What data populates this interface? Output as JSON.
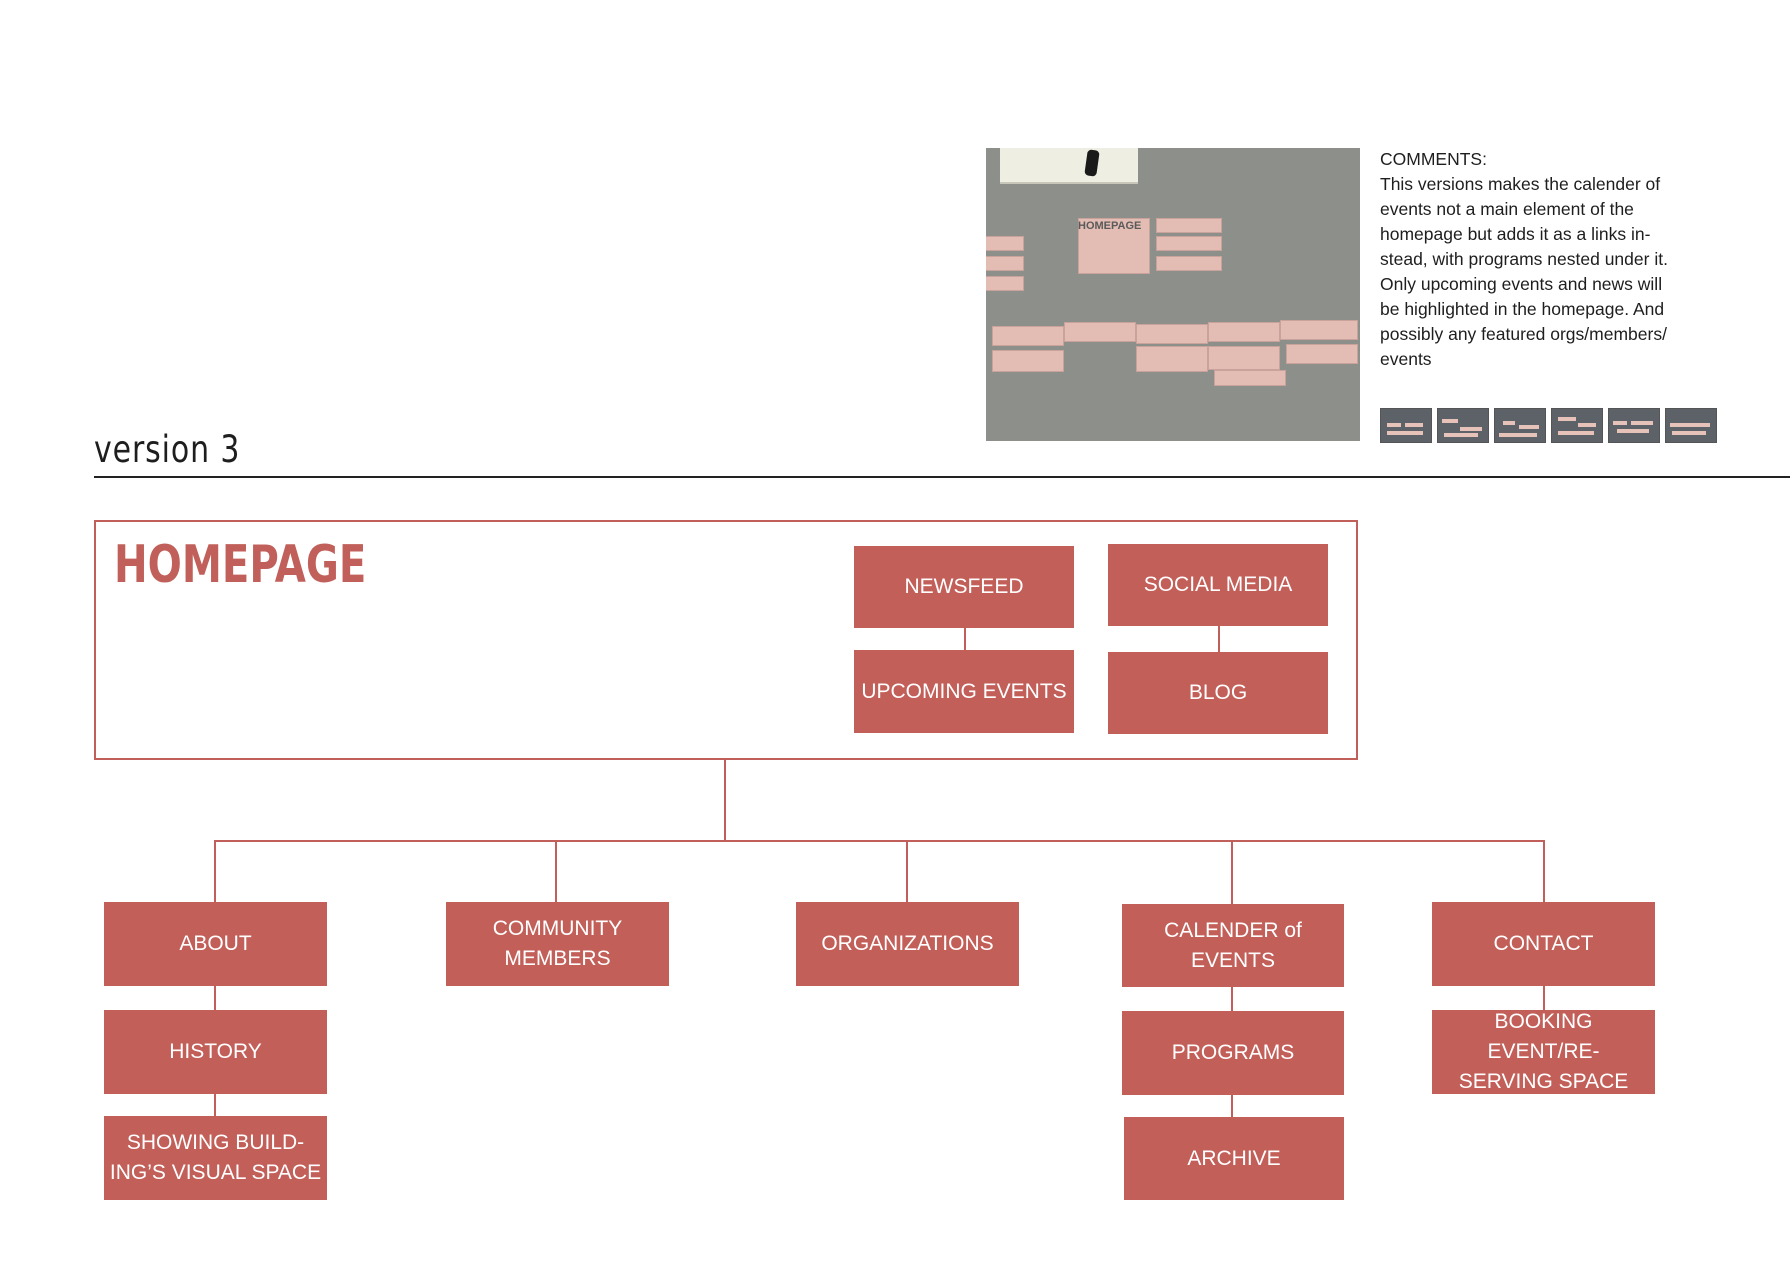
{
  "header": {
    "version_title": "version 3"
  },
  "comments": {
    "heading": "COMMENTS:",
    "lines": [
      "This versions makes the calender of",
      "events not a main element of the",
      "homepage but adds it as a links in-",
      "stead, with programs nested under it.",
      "Only upcoming events and news will",
      "be highlighted in the homepage. And",
      "possibly any featured orgs/members/",
      "events"
    ]
  },
  "photo": {
    "card_label": "HOMEPAGE"
  },
  "thumbnails": {
    "count": 6
  },
  "sitemap": {
    "homepage": {
      "title": "HOMEPAGE",
      "blocks": {
        "newsfeed": "NEWSFEED",
        "upcoming_events": "UPCOMING EVENTS",
        "social_media": "SOCIAL MEDIA",
        "blog": "BLOG"
      }
    },
    "sections": {
      "about": "ABOUT",
      "history": "HISTORY",
      "showing_space": "SHOWING BUILD-\nING’S VISUAL SPACE",
      "community_members": "COMMUNITY\nMEMBERS",
      "organizations": "ORGANIZATIONS",
      "calender": "CALENDER of EVENTS",
      "programs": "PROGRAMS",
      "archive": "ARCHIVE",
      "contact": "CONTACT",
      "booking": "BOOKING EVENT/RE-\nSERVING SPACE"
    }
  },
  "colors": {
    "accent": "#c35f59",
    "text": "#1e1e1e"
  }
}
